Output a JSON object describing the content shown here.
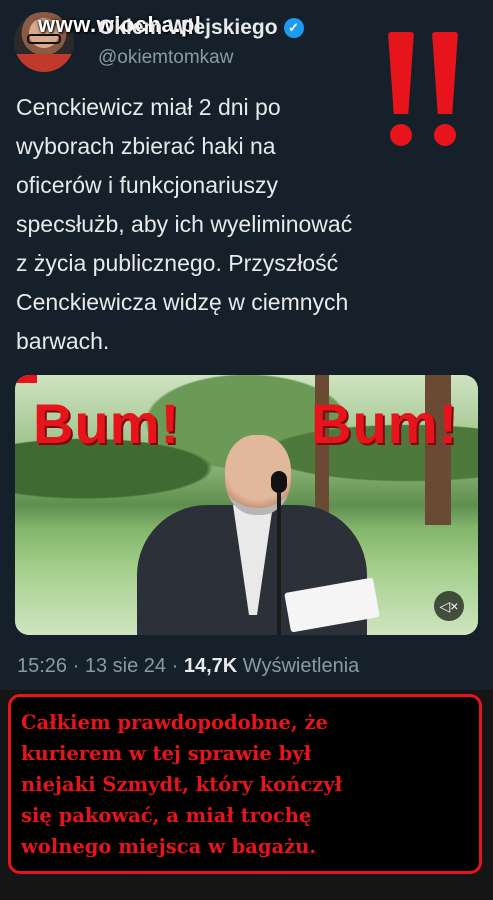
{
  "watermark": "www.wiocha.pl",
  "author": {
    "name": "Okiem Wiejskiego",
    "handle": "@okiemtomkaw",
    "verified_color": "#1d9bf0"
  },
  "post": {
    "lines": [
      "Cenckiewicz miał 2 dni po",
      "wyborach zbierać haki na",
      "oficerów i funkcjonariuszy",
      "specsłużb, aby ich wyeliminować",
      "z życia publicznego. Przyszłość",
      "Cenckiewicza widzę w ciemnych",
      "barwach."
    ]
  },
  "video": {
    "overlay_left": "Bum!",
    "overlay_right": "Bum!",
    "mute_icon": "speaker-muted-icon"
  },
  "meta": {
    "time": "15:26",
    "sep1": "·",
    "date": "13 sie 24",
    "sep2": "·",
    "views_count": "14,7K",
    "views_label": "Wyświetlenia"
  },
  "caption": {
    "lines": [
      "Całkiem prawdopodobne, że",
      "kurierem w tej sprawie był",
      "niejaki Szmydt, który kończył",
      "się pakować, a miał trochę",
      "wolnego miejsca w bagażu."
    ]
  },
  "colors": {
    "background": "#15202b",
    "accent_red": "#e8141c",
    "text": "#e7e9ea",
    "muted": "#8b98a5"
  }
}
